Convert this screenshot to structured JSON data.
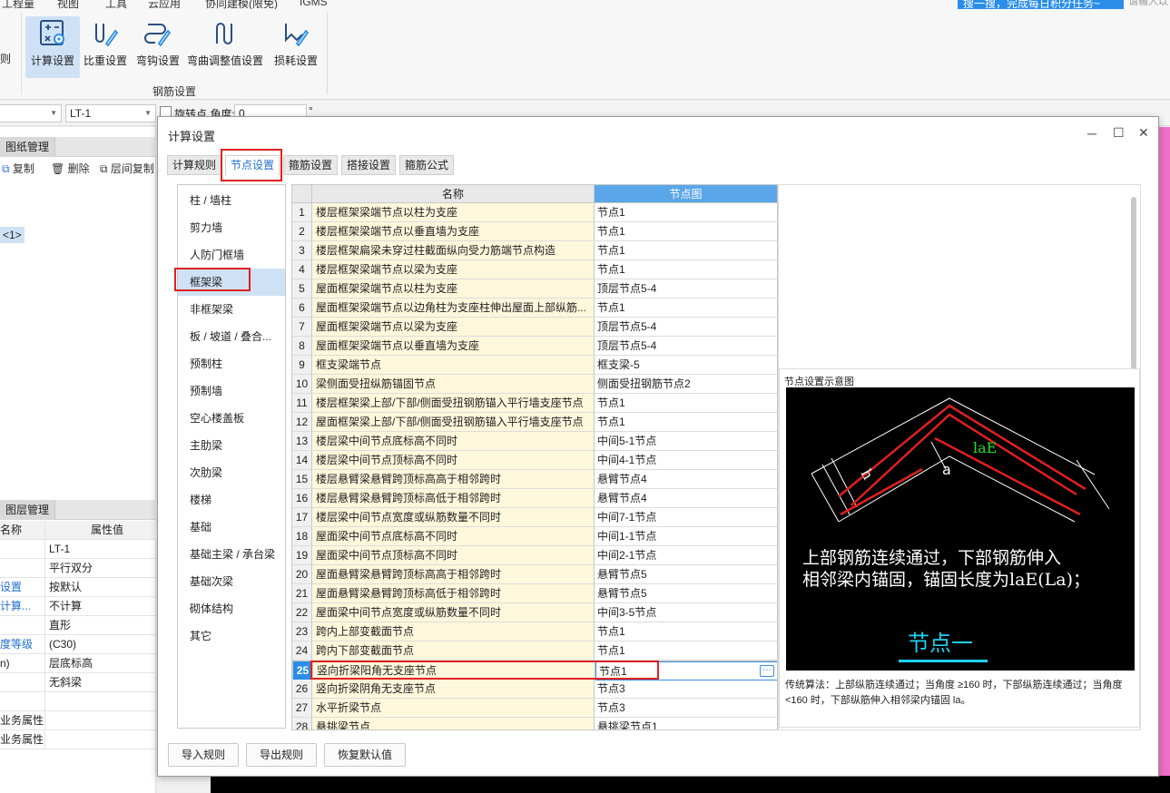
{
  "menu": [
    "工程量",
    "视图",
    "工具",
    "云应用",
    "协同建模(限免)",
    "IGMS"
  ],
  "tip": {
    "text": "搜一搜，完成每日积分任务~",
    "search_placeholder": "请输入以"
  },
  "ribbon": {
    "left_partial": "则",
    "buttons": [
      "计算设置",
      "比重设置",
      "弯钩设置",
      "弯曲调整值设置",
      "损耗设置"
    ],
    "group_label": "钢筋设置"
  },
  "toolbar2": {
    "select1": "",
    "select2": "LT-1",
    "rotate_label": "旋转点 角度:",
    "angle_value": "0",
    "degree": "°"
  },
  "left_panel": {
    "drawing_tab": "图纸管理",
    "tools": [
      "复制",
      "删除",
      "层间复制"
    ],
    "tree_item": "<1>",
    "layer_tab": "图层管理",
    "prop_header": {
      "name": "名称",
      "value": "属性值"
    },
    "props": [
      {
        "k": "",
        "v": "LT-1",
        "blue": false
      },
      {
        "k": "",
        "v": "平行双分",
        "blue": false
      },
      {
        "k": "设置",
        "v": "按默认",
        "blue": true
      },
      {
        "k": "计算...",
        "v": "不计算",
        "blue": true
      },
      {
        "k": "",
        "v": "直形",
        "blue": false
      },
      {
        "k": "度等级",
        "v": "(C30)",
        "blue": true
      },
      {
        "k": "n)",
        "v": "层底标高",
        "blue": false
      },
      {
        "k": "",
        "v": "无斜梁",
        "blue": false
      },
      {
        "k": "",
        "v": "",
        "blue": false
      },
      {
        "k": "业务属性",
        "v": "",
        "blue": false
      },
      {
        "k": "业务属性",
        "v": "",
        "blue": false
      }
    ]
  },
  "dialog": {
    "title": "计算设置",
    "tabs": [
      "计算规则",
      "节点设置",
      "箍筋设置",
      "搭接设置",
      "箍筋公式"
    ],
    "active_tab": 1,
    "categories": [
      "柱 / 墙柱",
      "剪力墙",
      "人防门框墙",
      "框架梁",
      "非框架梁",
      "板 / 坡道 / 叠合...",
      "预制柱",
      "预制墙",
      "空心楼盖板",
      "主肋梁",
      "次肋梁",
      "楼梯",
      "基础",
      "基础主梁 / 承台梁",
      "基础次梁",
      "砌体结构",
      "其它"
    ],
    "active_category": 3,
    "columns": {
      "name": "名称",
      "node": "节点图"
    },
    "rows": [
      {
        "n": "1",
        "name": "楼层框架梁端节点以柱为支座",
        "node": "节点1"
      },
      {
        "n": "2",
        "name": "楼层框架梁端节点以垂直墙为支座",
        "node": "节点1"
      },
      {
        "n": "3",
        "name": "楼层框架扁梁未穿过柱截面纵向受力筋端节点构造",
        "node": "节点1"
      },
      {
        "n": "4",
        "name": "楼层框架梁端节点以梁为支座",
        "node": "节点1"
      },
      {
        "n": "5",
        "name": "屋面框架梁端节点以柱为支座",
        "node": "顶层节点5-4"
      },
      {
        "n": "6",
        "name": "屋面框架梁端节点以边角柱为支座柱伸出屋面上部纵筋...",
        "node": "节点1"
      },
      {
        "n": "7",
        "name": "屋面框架梁端节点以梁为支座",
        "node": "顶层节点5-4"
      },
      {
        "n": "8",
        "name": "屋面框架梁端节点以垂直墙为支座",
        "node": "顶层节点5-4"
      },
      {
        "n": "9",
        "name": "框支梁端节点",
        "node": "框支梁-5"
      },
      {
        "n": "10",
        "name": "梁侧面受扭纵筋锚固节点",
        "node": "侧面受扭钢筋节点2"
      },
      {
        "n": "11",
        "name": "楼层框架梁上部/下部/侧面受扭钢筋锚入平行墙支座节点",
        "node": "节点1"
      },
      {
        "n": "12",
        "name": "屋面框架梁上部/下部/侧面受扭钢筋锚入平行墙支座节点",
        "node": "节点1"
      },
      {
        "n": "13",
        "name": "楼层梁中间节点底标高不同时",
        "node": "中间5-1节点"
      },
      {
        "n": "14",
        "name": "楼层梁中间节点顶标高不同时",
        "node": "中间4-1节点"
      },
      {
        "n": "15",
        "name": "楼层悬臂梁悬臂跨顶标高高于相邻跨时",
        "node": "悬臂节点4"
      },
      {
        "n": "16",
        "name": "楼层悬臂梁悬臂跨顶标高低于相邻跨时",
        "node": "悬臂节点4"
      },
      {
        "n": "17",
        "name": "楼层梁中间节点宽度或纵筋数量不同时",
        "node": "中间7-1节点"
      },
      {
        "n": "18",
        "name": "屋面梁中间节点底标高不同时",
        "node": "中间1-1节点"
      },
      {
        "n": "19",
        "name": "屋面梁中间节点顶标高不同时",
        "node": "中间2-1节点"
      },
      {
        "n": "20",
        "name": "屋面悬臂梁悬臂跨顶标高高于相邻跨时",
        "node": "悬臂节点5"
      },
      {
        "n": "21",
        "name": "屋面悬臂梁悬臂跨顶标高低于相邻跨时",
        "node": "悬臂节点5"
      },
      {
        "n": "22",
        "name": "屋面梁中间节点宽度或纵筋数量不同时",
        "node": "中间3-5节点"
      },
      {
        "n": "23",
        "name": "跨内上部变截面节点",
        "node": "节点1"
      },
      {
        "n": "24",
        "name": "跨内下部变截面节点",
        "node": "节点1"
      },
      {
        "n": "25",
        "name": "竖向折梁阳角无支座节点",
        "node": "节点1"
      },
      {
        "n": "26",
        "name": "竖向折梁阴角无支座节点",
        "node": "节点3"
      },
      {
        "n": "27",
        "name": "水平折梁节点",
        "node": "节点3"
      },
      {
        "n": "28",
        "name": "悬挑梁节点",
        "node": "悬挑梁节点1"
      }
    ],
    "selected_row": 24,
    "preview": {
      "title": "节点设置示意图",
      "label_lae": "laE",
      "label_h": "h",
      "label_a": "a",
      "line1": "上部钢筋连续通过，下部钢筋伸入",
      "line2": "相邻梁内锚固，锚固长度为laE(La)；",
      "node_name": "节点一",
      "desc": "传统算法：上部纵筋连续通过；当角度 ≥160 时，下部纵筋连续通过；当角度 <160 时，下部纵筋伸入相邻梁内锚固 la。"
    },
    "buttons": [
      "导入规则",
      "导出规则",
      "恢复默认值"
    ]
  },
  "colors": {
    "accent": "#2a8ee8",
    "highlight": "#e02020",
    "selection": "#cfe2f5"
  }
}
